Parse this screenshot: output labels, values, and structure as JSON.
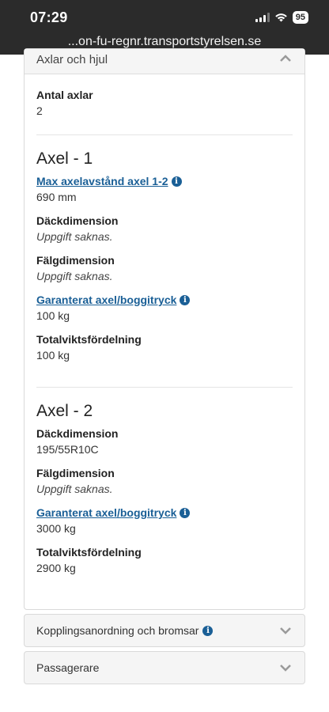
{
  "statusbar": {
    "time": "07:29",
    "battery": "95"
  },
  "browser": {
    "url": "...on-fu-regnr.transportstyrelsen.se"
  },
  "panel_main": {
    "title": "Axlar och hjul",
    "antal": {
      "label": "Antal axlar",
      "value": "2"
    },
    "axel1": {
      "title": "Axel - 1",
      "max_link": "Max axelavstånd axel 1-2",
      "max_value": "690 mm",
      "dack_label": "Däckdimension",
      "dack_value": "Uppgift saknas.",
      "falg_label": "Fälgdimension",
      "falg_value": "Uppgift saknas.",
      "gar_link": "Garanterat axel/boggitryck",
      "gar_value": "100 kg",
      "tot_label": "Totalviktsfördelning",
      "tot_value": "100 kg"
    },
    "axel2": {
      "title": "Axel - 2",
      "dack_label": "Däckdimension",
      "dack_value": "195/55R10C",
      "falg_label": "Fälgdimension",
      "falg_value": "Uppgift saknas.",
      "gar_link": "Garanterat axel/boggitryck",
      "gar_value": "3000 kg",
      "tot_label": "Totalviktsfördelning",
      "tot_value": "2900 kg"
    }
  },
  "panel_koppling": {
    "title": "Kopplingsanordning och bromsar"
  },
  "panel_passagerare": {
    "title": "Passagerare"
  },
  "icons": {
    "info": "i"
  },
  "colors": {
    "topbar": "#2b2b2b",
    "link": "#1a5f96",
    "panel_header": "#f5f5f5"
  }
}
